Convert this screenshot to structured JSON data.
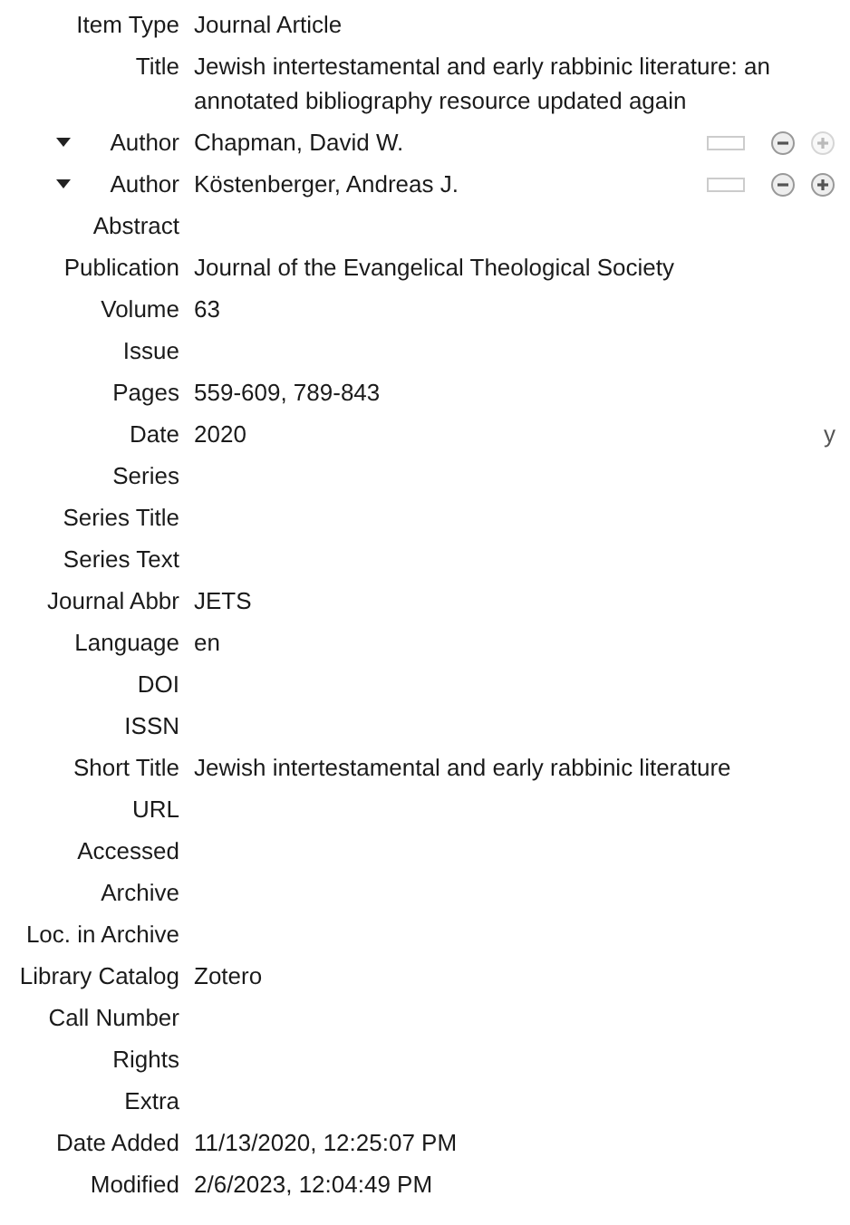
{
  "fields": [
    {
      "kind": "text",
      "label": "Item Type",
      "value": "Journal Article"
    },
    {
      "kind": "text",
      "label": "Title",
      "value": "Jewish intertestamental and early rabbinic literature: an annotated bibliography resource updated again"
    },
    {
      "kind": "creator",
      "label": "Author",
      "value": "Chapman, David W.",
      "expanded": true,
      "plus_enabled": false
    },
    {
      "kind": "creator",
      "label": "Author",
      "value": "Köstenberger, Andreas J.",
      "expanded": true,
      "plus_enabled": true
    },
    {
      "kind": "text",
      "label": "Abstract"
    },
    {
      "kind": "text",
      "label": "Publication",
      "value": "Journal of the Evangelical Theological Society"
    },
    {
      "kind": "text",
      "label": "Volume",
      "value": "63"
    },
    {
      "kind": "text",
      "label": "Issue"
    },
    {
      "kind": "text",
      "label": "Pages",
      "value": "559-609, 789-843"
    },
    {
      "kind": "date",
      "label": "Date",
      "value": "2020",
      "format": "y"
    },
    {
      "kind": "text",
      "label": "Series"
    },
    {
      "kind": "text",
      "label": "Series Title"
    },
    {
      "kind": "text",
      "label": "Series Text"
    },
    {
      "kind": "text",
      "label": "Journal Abbr",
      "value": "JETS"
    },
    {
      "kind": "text",
      "label": "Language",
      "value": "en"
    },
    {
      "kind": "text",
      "label": "DOI"
    },
    {
      "kind": "text",
      "label": "ISSN"
    },
    {
      "kind": "text",
      "label": "Short Title",
      "value": "Jewish intertestamental and early rabbinic literature"
    },
    {
      "kind": "text",
      "label": "URL"
    },
    {
      "kind": "text",
      "label": "Accessed"
    },
    {
      "kind": "text",
      "label": "Archive"
    },
    {
      "kind": "text",
      "label": "Loc. in Archive"
    },
    {
      "kind": "text",
      "label": "Library Catalog",
      "value": "Zotero"
    },
    {
      "kind": "text",
      "label": "Call Number"
    },
    {
      "kind": "text",
      "label": "Rights"
    },
    {
      "kind": "text",
      "label": "Extra"
    },
    {
      "kind": "text",
      "label": "Date Added",
      "value": "11/13/2020, 12:25:07 PM"
    },
    {
      "kind": "text",
      "label": "Modified",
      "value": "2/6/2023, 12:04:49 PM"
    }
  ]
}
